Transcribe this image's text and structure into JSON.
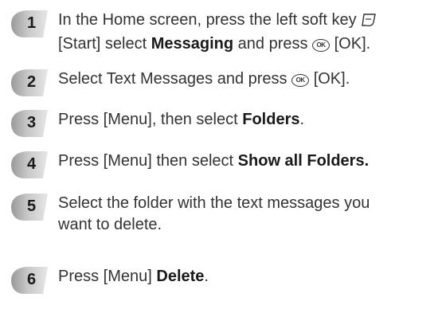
{
  "steps": [
    {
      "number": "1",
      "line1_a": "In the Home screen, press the left soft key",
      "line2_a": "[Start] select",
      "line2_bold": "Messaging",
      "line2_b": "and press",
      "line2_c": "[OK]."
    },
    {
      "number": "2",
      "text_a": "Select Text Messages and press",
      "text_b": "[OK]."
    },
    {
      "number": "3",
      "text_a": "Press [Menu], then select",
      "text_bold": "Folders",
      "text_b": "."
    },
    {
      "number": "4",
      "text_a": "Press [Menu] then select",
      "text_bold": "Show all Folders."
    },
    {
      "number": "5",
      "line1": "Select the folder with the text messages you",
      "line2": "want to delete."
    },
    {
      "number": "6",
      "text_a": "Press [Menu]",
      "text_bold": "Delete",
      "text_b": "."
    }
  ],
  "icons": {
    "ok_key": "OK",
    "ok_key_name": "ok-key-icon",
    "soft_key_name": "left-soft-key-icon"
  },
  "colors": {
    "badge_fill": "#b8b8b8",
    "badge_dark": "#8a8a8a",
    "text": "#333333"
  }
}
